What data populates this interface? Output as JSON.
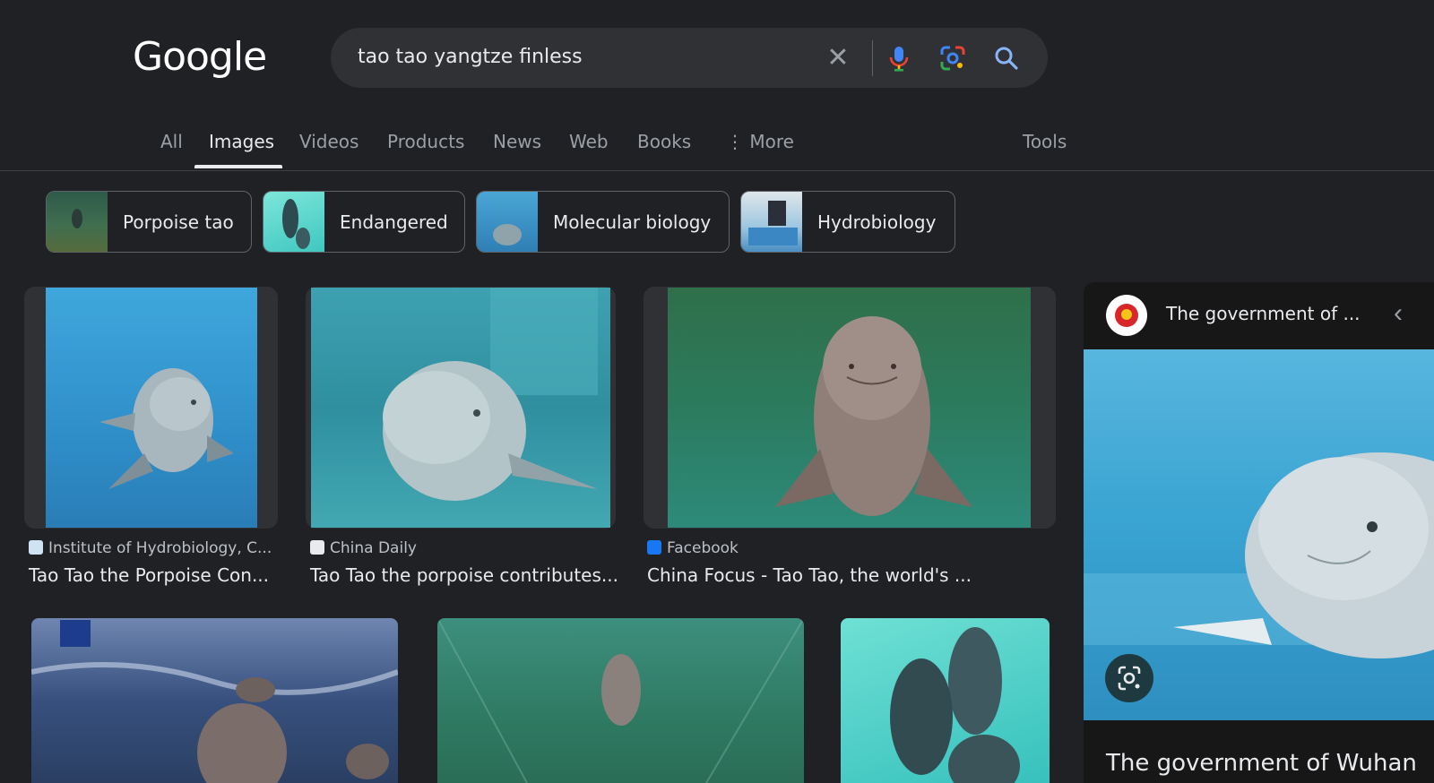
{
  "logo": "Google",
  "search": {
    "query": "tao tao yangtze finless"
  },
  "tabs": [
    {
      "label": "All"
    },
    {
      "label": "Images"
    },
    {
      "label": "Videos"
    },
    {
      "label": "Products"
    },
    {
      "label": "News"
    },
    {
      "label": "Web"
    },
    {
      "label": "Books"
    },
    {
      "label": "More"
    }
  ],
  "tools_label": "Tools",
  "chips": [
    {
      "label": "Porpoise tao"
    },
    {
      "label": "Endangered"
    },
    {
      "label": "Molecular biology"
    },
    {
      "label": "Hydrobiology"
    }
  ],
  "results": [
    {
      "source": "Institute of Hydrobiology, C...",
      "title": "Tao Tao the Porpoise Con..."
    },
    {
      "source": "China Daily",
      "title": "Tao Tao the porpoise contributes..."
    },
    {
      "source": "Facebook",
      "title": "China Focus - Tao Tao, the world's ..."
    }
  ],
  "panel": {
    "source": "The government of ...",
    "caption": "The government of Wuhan"
  },
  "colors": {
    "background": "#202124",
    "search_bg": "#303134",
    "text": "#e8eaed",
    "muted": "#9aa0a6",
    "facebook": "#1877f2"
  },
  "icons": [
    "clear-icon",
    "mic-icon",
    "lens-icon",
    "search-icon",
    "more-dots-icon",
    "chevron-left-icon",
    "visual-search-icon"
  ]
}
